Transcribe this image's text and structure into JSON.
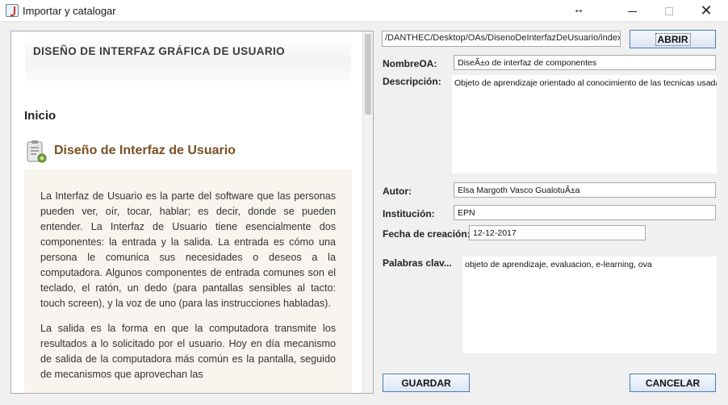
{
  "window": {
    "title": "Importar y catalogar",
    "resize_glyph": "↔",
    "close_glyph": "✕"
  },
  "browser": {
    "banner_title": "DISEÑO DE INTERFAZ GRÁFICA DE USUARIO",
    "heading": "Inicio",
    "section_title": "Diseño de Interfaz de Usuario",
    "paragraphs": [
      "La Interfaz de Usuario es la parte del software que las personas pueden ver, oír, tocar, hablar; es decir, donde se pueden entender. La Interfaz de Usuario tiene esencialmente dos componentes: la entrada y la salida. La entrada es cómo una persona le comunica sus necesidades o deseos a la computadora. Algunos componentes de entrada comunes son el teclado, el ratón, un dedo (para pantallas sensibles al tacto: touch screen), y la voz de uno (para las instrucciones habladas).",
      "La salida es la forma en que la computadora transmite los resultados a lo solicitado por el usuario. Hoy en día mecanismo de salida de la computadora más común es la pantalla, seguido de mecanismos que aprovechan las"
    ]
  },
  "form": {
    "path": "/DANTHEC/Desktop/OAs/DisenoDeInterfazDeUsuario/index.html",
    "open_button": "ABRIR",
    "nombre_label": "NombreOA:",
    "nombre_value": "DiseÃ±o de interfaz de componentes",
    "descripcion_label": "Descripción:",
    "descripcion_value": "Objeto de aprendizaje orientado al conocimiento de las tecnicas usadas p",
    "autor_label": "Autor:",
    "autor_value": "Elsa Margoth Vasco GualotuÃ±a",
    "institucion_label": "Institución:",
    "institucion_value": "EPN",
    "fecha_label": "Fecha de creación:",
    "fecha_value": "12-12-2017",
    "palabras_label": "Palabras clav...",
    "palabras_value": "objeto de aprendizaje, evaluacion, e-learning, ova",
    "save_button": "GUARDAR",
    "cancel_button": "CANCELAR"
  },
  "colors": {
    "accent_border": "#4d7db5",
    "section_title": "#7b4f23",
    "content_bg": "#f7f5ee"
  }
}
